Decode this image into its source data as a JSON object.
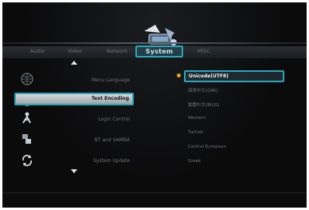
{
  "header": {
    "active_tab": "System",
    "tabs": [
      {
        "label": "Audio"
      },
      {
        "label": "Video"
      },
      {
        "label": "Network"
      },
      {
        "label": "System"
      },
      {
        "label": "MISC"
      }
    ]
  },
  "left_menu": {
    "items": [
      {
        "label": "Menu Language",
        "icon": "globe-icon"
      },
      {
        "label": "Text Encoding",
        "icon": "text-encoding-icon",
        "selected": true
      },
      {
        "label": "Login Control",
        "icon": "login-icon"
      },
      {
        "label": "BT and SAMBA",
        "icon": "share-icon"
      },
      {
        "label": "System Update",
        "icon": "update-icon"
      }
    ]
  },
  "options": {
    "items": [
      {
        "label": "Unicode(UTF8)",
        "selected": true
      },
      {
        "label": "简体中文(GBK)"
      },
      {
        "label": "繁體中文(BIG5)"
      },
      {
        "label": "Western"
      },
      {
        "label": "Turkish"
      },
      {
        "label": "Central European"
      },
      {
        "label": "Greek"
      }
    ]
  },
  "colors": {
    "accent": "#2aa6b7",
    "bullet": "#e7a21e",
    "background": "#0b0b0c"
  }
}
